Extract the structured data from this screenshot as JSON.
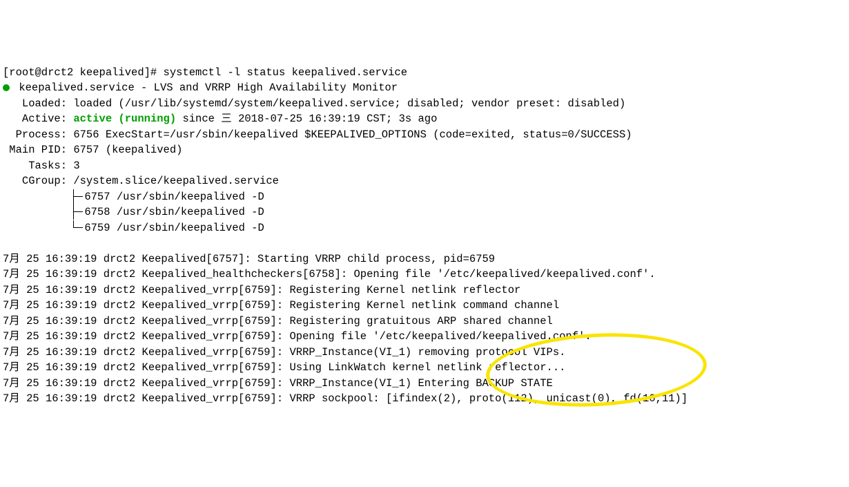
{
  "prompt": "[root@drct2 keepalived]# ",
  "command": "systemctl -l status keepalived.service",
  "service_line": "keepalived.service - LVS and VRRP High Availability Monitor",
  "loaded": "   Loaded: loaded (/usr/lib/systemd/system/keepalived.service; disabled; vendor preset: disabled)",
  "active_label": "   Active: ",
  "active_state": "active (running)",
  "active_since": " since 三 2018-07-25 16:39:19 CST; 3s ago",
  "process": "  Process: 6756 ExecStart=/usr/sbin/keepalived $KEEPALIVED_OPTIONS (code=exited, status=0/SUCCESS)",
  "main_pid": " Main PID: 6757 (keepalived)",
  "tasks": "    Tasks: 3",
  "cgroup": "   CGroup: /system.slice/keepalived.service",
  "cgroup_procs": [
    "6757 /usr/sbin/keepalived -D",
    "6758 /usr/sbin/keepalived -D",
    "6759 /usr/sbin/keepalived -D"
  ],
  "logs": [
    "7月 25 16:39:19 drct2 Keepalived[6757]: Starting VRRP child process, pid=6759",
    "7月 25 16:39:19 drct2 Keepalived_healthcheckers[6758]: Opening file '/etc/keepalived/keepalived.conf'.",
    "7月 25 16:39:19 drct2 Keepalived_vrrp[6759]: Registering Kernel netlink reflector",
    "7月 25 16:39:19 drct2 Keepalived_vrrp[6759]: Registering Kernel netlink command channel",
    "7月 25 16:39:19 drct2 Keepalived_vrrp[6759]: Registering gratuitous ARP shared channel",
    "7月 25 16:39:19 drct2 Keepalived_vrrp[6759]: Opening file '/etc/keepalived/keepalived.conf'.",
    "7月 25 16:39:19 drct2 Keepalived_vrrp[6759]: VRRP_Instance(VI_1) removing protocol VIPs.",
    "7月 25 16:39:19 drct2 Keepalived_vrrp[6759]: Using LinkWatch kernel netlink reflector...",
    "7月 25 16:39:19 drct2 Keepalived_vrrp[6759]: VRRP_Instance(VI_1) Entering BACKUP STATE",
    "7月 25 16:39:19 drct2 Keepalived_vrrp[6759]: VRRP sockpool: [ifindex(2), proto(112), unicast(0), fd(10,11)]"
  ]
}
